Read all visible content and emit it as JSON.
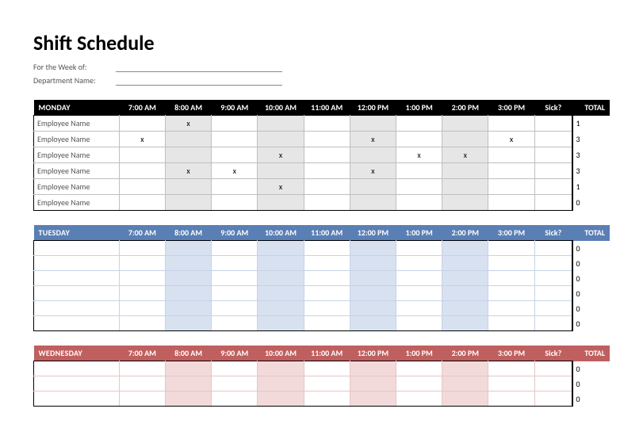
{
  "title": "Shift Schedule",
  "meta": {
    "week_label": "For the Week of:",
    "dept_label": "Department Name:",
    "week_value": "",
    "dept_value": ""
  },
  "time_headers": [
    "7:00 AM",
    "8:00 AM",
    "9:00 AM",
    "10:00 AM",
    "11:00 AM",
    "12:00 PM",
    "1:00 PM",
    "2:00 PM",
    "3:00 PM"
  ],
  "sick_header": "Sick?",
  "total_header": "TOTAL",
  "mark_char": "x",
  "days": [
    {
      "key": "mon",
      "name": "MONDAY",
      "rows": [
        {
          "emp": "Employee Name",
          "cells": [
            "",
            "x",
            "",
            "",
            "",
            "",
            "",
            "",
            "",
            ""
          ],
          "total": "1"
        },
        {
          "emp": "Employee Name",
          "cells": [
            "x",
            "",
            "",
            "",
            "",
            "x",
            "",
            "",
            "x",
            ""
          ],
          "total": "3"
        },
        {
          "emp": "Employee Name",
          "cells": [
            "",
            "",
            "",
            "x",
            "",
            "",
            "x",
            "x",
            "",
            ""
          ],
          "total": "3"
        },
        {
          "emp": "Employee Name",
          "cells": [
            "",
            "x",
            "x",
            "",
            "",
            "x",
            "",
            "",
            "",
            ""
          ],
          "total": "3"
        },
        {
          "emp": "Employee Name",
          "cells": [
            "",
            "",
            "",
            "x",
            "",
            "",
            "",
            "",
            "",
            ""
          ],
          "total": "1"
        },
        {
          "emp": "Employee Name",
          "cells": [
            "",
            "",
            "",
            "",
            "",
            "",
            "",
            "",
            "",
            ""
          ],
          "total": "0"
        }
      ]
    },
    {
      "key": "tue",
      "name": "TUESDAY",
      "rows": [
        {
          "emp": "",
          "cells": [
            "",
            "",
            "",
            "",
            "",
            "",
            "",
            "",
            "",
            ""
          ],
          "total": "0"
        },
        {
          "emp": "",
          "cells": [
            "",
            "",
            "",
            "",
            "",
            "",
            "",
            "",
            "",
            ""
          ],
          "total": "0"
        },
        {
          "emp": "",
          "cells": [
            "",
            "",
            "",
            "",
            "",
            "",
            "",
            "",
            "",
            ""
          ],
          "total": "0"
        },
        {
          "emp": "",
          "cells": [
            "",
            "",
            "",
            "",
            "",
            "",
            "",
            "",
            "",
            ""
          ],
          "total": "0"
        },
        {
          "emp": "",
          "cells": [
            "",
            "",
            "",
            "",
            "",
            "",
            "",
            "",
            "",
            ""
          ],
          "total": "0"
        },
        {
          "emp": "",
          "cells": [
            "",
            "",
            "",
            "",
            "",
            "",
            "",
            "",
            "",
            ""
          ],
          "total": "0"
        }
      ]
    },
    {
      "key": "wed",
      "name": "WEDNESDAY",
      "rows": [
        {
          "emp": "",
          "cells": [
            "",
            "",
            "",
            "",
            "",
            "",
            "",
            "",
            "",
            ""
          ],
          "total": "0"
        },
        {
          "emp": "",
          "cells": [
            "",
            "",
            "",
            "",
            "",
            "",
            "",
            "",
            "",
            ""
          ],
          "total": "0"
        },
        {
          "emp": "",
          "cells": [
            "",
            "",
            "",
            "",
            "",
            "",
            "",
            "",
            "",
            ""
          ],
          "total": "0"
        }
      ]
    }
  ]
}
